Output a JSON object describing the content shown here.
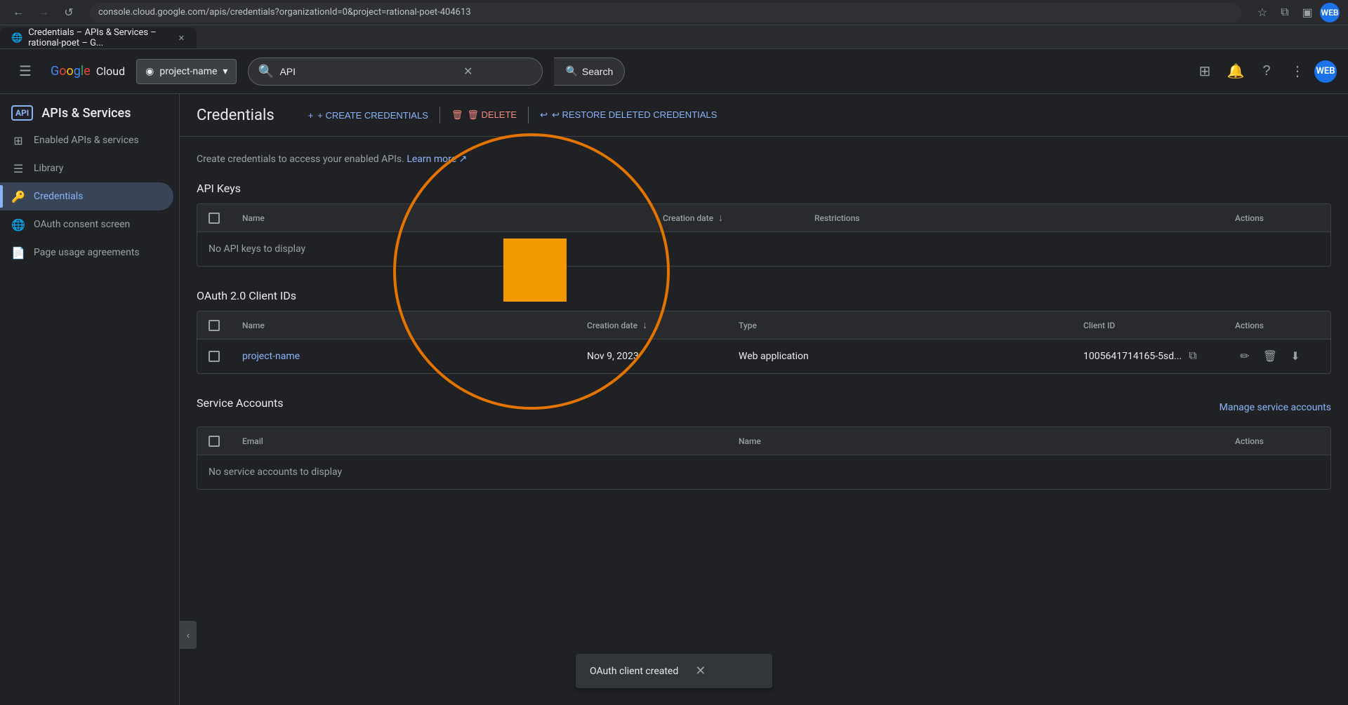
{
  "browser": {
    "url": "console.cloud.google.com/apis/credentials?organizationId=0&project=rational-poet-404613",
    "tab_title": "Credentials – APIs & Services – rational-poet – G...",
    "back_disabled": false,
    "forward_disabled": false
  },
  "header": {
    "hamburger_label": "☰",
    "logo_google": "Google",
    "logo_cloud": "Cloud",
    "project_name": "project-name",
    "search_placeholder": "API",
    "search_value": "API",
    "search_label": "Search",
    "clear_icon": "✕",
    "notifications_icon": "🔔",
    "help_icon": "?",
    "more_icon": "⋮",
    "user_initial": "WEB"
  },
  "sidebar": {
    "api_label": "API",
    "title": "APIs & Services",
    "items": [
      {
        "id": "enabled-apis",
        "icon": "⊞",
        "label": "Enabled APIs & services"
      },
      {
        "id": "library",
        "icon": "📚",
        "label": "Library"
      },
      {
        "id": "credentials",
        "icon": "🔑",
        "label": "Credentials",
        "active": true
      },
      {
        "id": "oauth-consent",
        "icon": "🌐",
        "label": "OAuth consent screen"
      },
      {
        "id": "page-usage",
        "icon": "📄",
        "label": "Page usage agreements"
      }
    ]
  },
  "page": {
    "title": "Credentials",
    "actions": {
      "create_label": "+ CREATE CREDENTIALS",
      "delete_label": "🗑 DELETE",
      "restore_label": "↩ RESTORE DELETED CREDENTIALS"
    },
    "info_text": "Create credentials to access your enabled APIs.",
    "learn_more_label": "Learn more",
    "sections": {
      "api_keys": {
        "title": "API Keys",
        "columns": {
          "name": "Name",
          "creation_date": "Creation date",
          "sort_icon": "↓",
          "restrictions": "Restrictions",
          "actions": "Actions"
        },
        "empty_text": "No API keys to display"
      },
      "oauth": {
        "title": "OAuth 2.0 Client IDs",
        "columns": {
          "name": "Name",
          "creation_date": "Creation date",
          "sort_icon": "↓",
          "type": "Type",
          "client_id": "Client ID",
          "actions": "Actions"
        },
        "rows": [
          {
            "name": "project-name",
            "creation_date": "Nov 9, 2023",
            "type": "Web application",
            "client_id": "1005641714165-5sd...",
            "client_id_full": "1005641714165-5sd..."
          }
        ]
      },
      "service_accounts": {
        "title": "Service Accounts",
        "manage_link": "Manage service accounts",
        "columns": {
          "email": "Email",
          "name": "Name",
          "actions": "Actions"
        },
        "empty_text": "No service accounts to display"
      }
    }
  },
  "spotlight": {
    "circle_color": "#e37400",
    "square_color": "#f29900"
  },
  "snackbar": {
    "message": "OAuth client created",
    "close_icon": "✕"
  },
  "icons": {
    "search": "🔍",
    "back": "←",
    "forward": "→",
    "reload": "↺",
    "star": "☆",
    "extension": "⧉",
    "grid": "⊞",
    "copy": "⧉",
    "edit": "✏",
    "delete": "🗑",
    "download": "⬇",
    "collapse_sidebar": "‹"
  }
}
